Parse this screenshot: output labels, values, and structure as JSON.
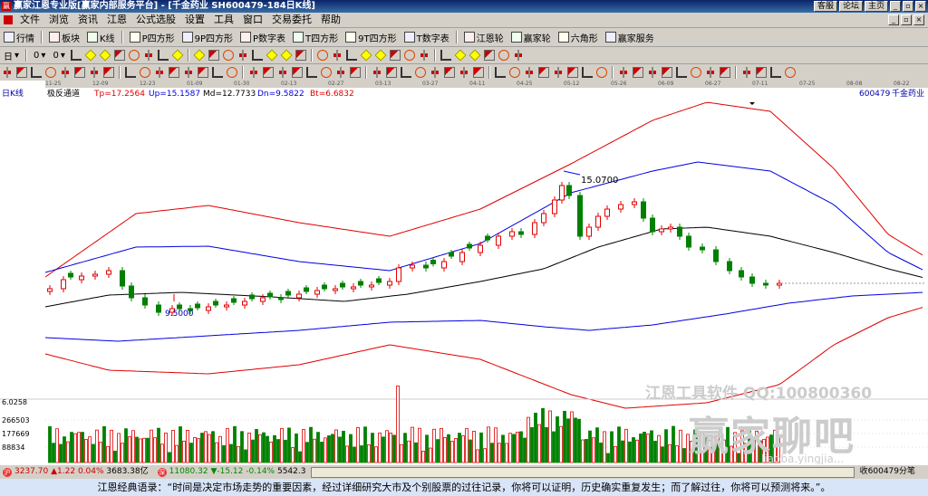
{
  "window": {
    "logo": "赢",
    "title": "赢家江恩专业版[赢家内部服务平台] - [千金药业  SH600479-184日K线]",
    "buttons": [
      "客服",
      "论坛",
      "主页"
    ],
    "controls": [
      "_",
      "▫",
      "×"
    ]
  },
  "menu": {
    "items": [
      "文件",
      "浏览",
      "资讯",
      "江恩",
      "公式选股",
      "设置",
      "工具",
      "窗口",
      "交易委托",
      "帮助"
    ],
    "controls": [
      "_",
      "▫",
      "×"
    ]
  },
  "toolbar1": {
    "items": [
      {
        "label": "行情",
        "icon": "grid-icon"
      },
      {
        "label": "板块",
        "icon": "blocks-icon"
      },
      {
        "label": "K线",
        "icon": "candle-icon"
      },
      {
        "label": "P四方形",
        "icon": "p-square-icon"
      },
      {
        "label": "9P四方形",
        "icon": "9p-square-icon"
      },
      {
        "label": "P数字表",
        "icon": "p-table-icon"
      },
      {
        "label": "T四方形",
        "icon": "t-square-icon"
      },
      {
        "label": "9T四方形",
        "icon": "9t-square-icon"
      },
      {
        "label": "T数字表",
        "icon": "t-table-icon"
      },
      {
        "label": "江恩轮",
        "icon": "gann-wheel-icon"
      },
      {
        "label": "赢家轮",
        "icon": "winner-wheel-icon"
      },
      {
        "label": "六角形",
        "icon": "hexagon-icon"
      },
      {
        "label": "赢家服务",
        "icon": "service-icon"
      }
    ]
  },
  "toolbar2_labels": [
    "日",
    "0",
    "0"
  ],
  "dates": [
    "11-25",
    "12-09",
    "12-23",
    "01-09",
    "01-30",
    "02-13",
    "02-27",
    "03-13",
    "03-27",
    "04-11",
    "04-25",
    "05-12",
    "05-26",
    "06-09",
    "06-27",
    "07-11",
    "07-25",
    "08-08",
    "08-22"
  ],
  "indicator": {
    "period": "日K线",
    "name": "极反通道",
    "tp": "Tp=17.2564",
    "up": "Up=15.1587",
    "md": "Md=12.7733",
    "dn": "Dn=9.5822",
    "bt": "Bt=6.6832",
    "code": "600479",
    "stock": "千金药业",
    "colors": {
      "tp": "#e00000",
      "up": "#0000e0",
      "md": "#000000",
      "dn": "#0000e0",
      "bt": "#e00000"
    }
  },
  "annotations": {
    "high": "15.0700",
    "low": "9.5000"
  },
  "volume": {
    "label_top": "6.0258",
    "ticks": [
      "266503",
      "177669",
      "88834"
    ]
  },
  "watermark": {
    "software": "江恩工具软件  QQ:100800360",
    "brand": "赢家聊吧",
    "url": "liaoba.yingjia..."
  },
  "status": {
    "index1": "3237.70",
    "index1_change": "▲1.22",
    "index1_pct": "0.04%",
    "index1_amount": "3683.38亿",
    "index2": "11080.32",
    "index2_change": "▼-15.12",
    "index2_pct": "-0.14%",
    "index2_amount": "5542.3",
    "right": "收600479分笔"
  },
  "quote": "江恩经典语录：“时间是决定市场走势的重要因素，经过详细研究大市及个别股票的过往记录，你将可以证明，历史确实重复发生；而了解过往，你将可以预测将来。”。",
  "chart_data": {
    "type": "candlestick",
    "title": "",
    "price_labels": {
      "high": 15.07,
      "low": 9.5
    },
    "channel": {
      "Tp": 17.2564,
      "Up": 15.1587,
      "Md": 12.7733,
      "Dn": 9.5822,
      "Bt": 6.6832
    }
  }
}
